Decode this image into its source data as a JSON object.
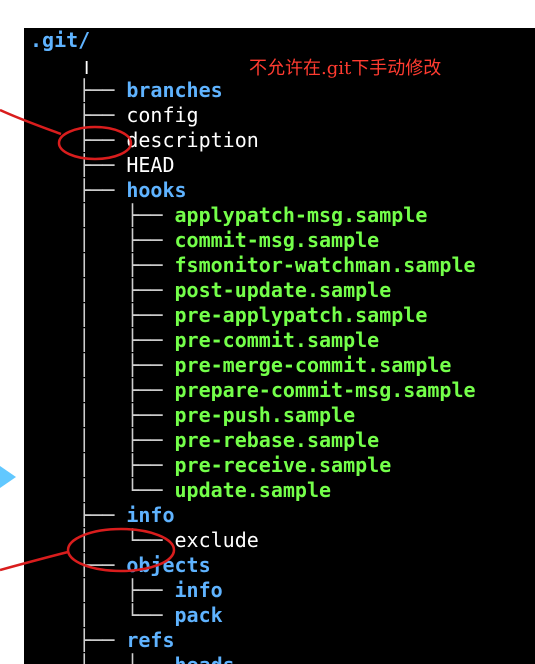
{
  "tree": {
    "root": ".git/",
    "annotation": "不允许在.git下手动修改",
    "items": [
      {
        "guide": "├── ",
        "name": "branches"
      },
      {
        "guide": "├── ",
        "name": "config"
      },
      {
        "guide": "├── ",
        "name": "description"
      },
      {
        "guide": "├── ",
        "name": "HEAD"
      },
      {
        "guide": "├── ",
        "name": "hooks"
      },
      {
        "guide": "│   ├── ",
        "name": "applypatch-msg.sample"
      },
      {
        "guide": "│   ├── ",
        "name": "commit-msg.sample"
      },
      {
        "guide": "│   ├── ",
        "name": "fsmonitor-watchman.sample"
      },
      {
        "guide": "│   ├── ",
        "name": "post-update.sample"
      },
      {
        "guide": "│   ├── ",
        "name": "pre-applypatch.sample"
      },
      {
        "guide": "│   ├── ",
        "name": "pre-commit.sample"
      },
      {
        "guide": "│   ├── ",
        "name": "pre-merge-commit.sample"
      },
      {
        "guide": "│   ├── ",
        "name": "prepare-commit-msg.sample"
      },
      {
        "guide": "│   ├── ",
        "name": "pre-push.sample"
      },
      {
        "guide": "│   ├── ",
        "name": "pre-rebase.sample"
      },
      {
        "guide": "│   ├── ",
        "name": "pre-receive.sample"
      },
      {
        "guide": "│   └── ",
        "name": "update.sample"
      },
      {
        "guide": "├── ",
        "name": "info"
      },
      {
        "guide": "│   └── ",
        "name": "exclude"
      },
      {
        "guide": "├── ",
        "name": "objects"
      },
      {
        "guide": "│   ├── ",
        "name": "info"
      },
      {
        "guide": "│   └── ",
        "name": "pack"
      },
      {
        "guide": "├── ",
        "name": "refs"
      },
      {
        "guide": "│   ├── ",
        "name": "heads"
      }
    ]
  },
  "colors": {
    "terminal_background": "#000000",
    "directory": "#5fb3ff",
    "file": "#ffffff",
    "sample": "#74ff4a",
    "annotation": "#ff3b30",
    "tree_lines": "#cfcfcf",
    "arrow": "#61c8ff"
  },
  "icons": {
    "cursor": "text-cursor-icon",
    "arrow": "left-arrow-icon"
  }
}
